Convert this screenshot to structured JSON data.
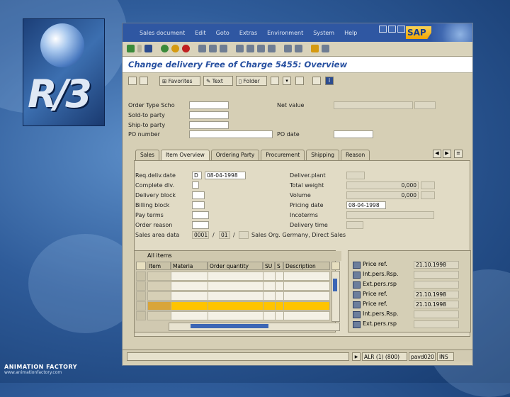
{
  "logo": {
    "text": "R/3"
  },
  "footer": {
    "brand": "ANIMATION FACTORY",
    "url": "www.animationfactory.com"
  },
  "window": {
    "menus": [
      "Sales document",
      "Edit",
      "Goto",
      "Extras",
      "Environment",
      "System",
      "Help"
    ],
    "sap_logo": "SAP",
    "title": "Change delivery Free of Charge 5455: Overview"
  },
  "toolbar2": {
    "favorites": "Favorites",
    "text": "Text",
    "folder": "Folder"
  },
  "header": {
    "order_type_label": "Order Type Scho",
    "sold_to_label": "Sold-to party",
    "ship_to_label": "Ship-to party",
    "po_number_label": "PO number",
    "net_value_label": "Net value",
    "po_date_label": "PO date"
  },
  "tabs": [
    "Sales",
    "Item Overview",
    "Ordering Party",
    "Procurement",
    "Shipping",
    "Reason"
  ],
  "item_overview": {
    "req_deliv_date_label": "Req.deliv.date",
    "req_deliv_date_unit": "D",
    "req_deliv_date_value": "08-04-1998",
    "complete_dlv_label": "Complete dlv.",
    "delivery_block_label": "Delivery block",
    "billing_block_label": "Billing block",
    "pay_terms_label": "Pay terms",
    "order_reason_label": "Order reason",
    "sales_area_label": "Sales area data",
    "sales_org": "0001",
    "dist_channel": "01",
    "sales_area_text": "Sales Org. Germany, Direct Sales",
    "deliver_plant_label": "Deliver.plant",
    "total_weight_label": "Total weight",
    "total_weight_value": "0,000",
    "volume_label": "Volume",
    "volume_value": "0,000",
    "pricing_date_label": "Pricing date",
    "pricing_date_value": "08-04-1998",
    "incoterms_label": "Incoterms",
    "delivery_time_label": "Delivery time"
  },
  "items_grid": {
    "title": "All items",
    "columns": [
      "Item",
      "Materia",
      "Order quantity",
      "SU",
      "S",
      "Description"
    ]
  },
  "side_panel": [
    {
      "name": "Price ref.",
      "value": "21.10.1998"
    },
    {
      "name": "Int.pers.Rsp.",
      "value": ""
    },
    {
      "name": "Ext.pers.rsp",
      "value": ""
    },
    {
      "name": "Price ref.",
      "value": "21.10.1998"
    },
    {
      "name": "Price ref.",
      "value": "21.10.1998"
    },
    {
      "name": "Int.pers.Rsp.",
      "value": ""
    },
    {
      "name": "Ext.pers.rsp",
      "value": ""
    }
  ],
  "status": {
    "system": "ALR (1) (800)",
    "server": "pavd020",
    "mode": "INS"
  }
}
